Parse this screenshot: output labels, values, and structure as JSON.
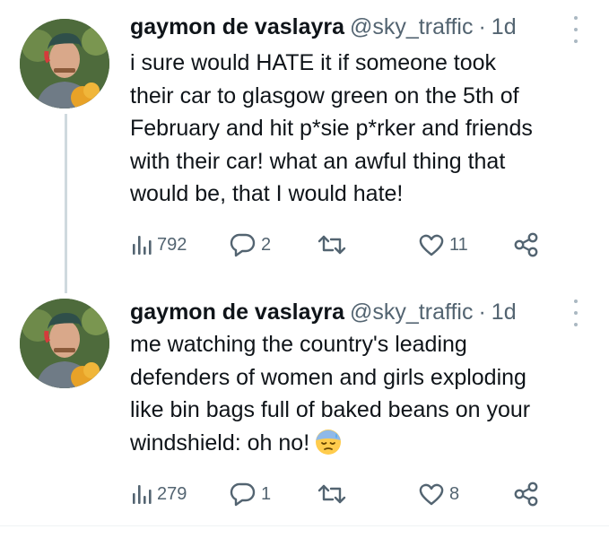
{
  "tweets": [
    {
      "author_name": "gaymon de vaslayra",
      "handle": "@sky_traffic",
      "separator": "·",
      "time": "1d",
      "text": "i sure would HATE it if someone took\ntheir car to glasgow green on the 5th of\nFebruary and hit p*sie p*rker and friends\nwith their car! what an awful thing that\nwould be, that I would hate!",
      "emoji": "",
      "views": "792",
      "replies": "2",
      "retweets": "",
      "likes": "11"
    },
    {
      "author_name": "gaymon de vaslayra",
      "handle": "@sky_traffic",
      "separator": "·",
      "time": "1d",
      "text": "me watching the country's leading\ndefenders of women and girls exploding\nlike bin bags full of baked beans on your\nwindshield: oh no!",
      "emoji": "downcast-face-with-sweat",
      "views": "279",
      "replies": "1",
      "retweets": "",
      "likes": "8"
    }
  ],
  "icons": {
    "views": "bar-chart-icon",
    "reply": "reply-bubble-icon",
    "retweet": "retweet-icon",
    "like": "heart-icon",
    "share": "share-icon",
    "more": "more-vertical-icon"
  },
  "colors": {
    "text_primary": "#0f1419",
    "text_secondary": "#536471",
    "thread_line": "#cfd9de"
  }
}
